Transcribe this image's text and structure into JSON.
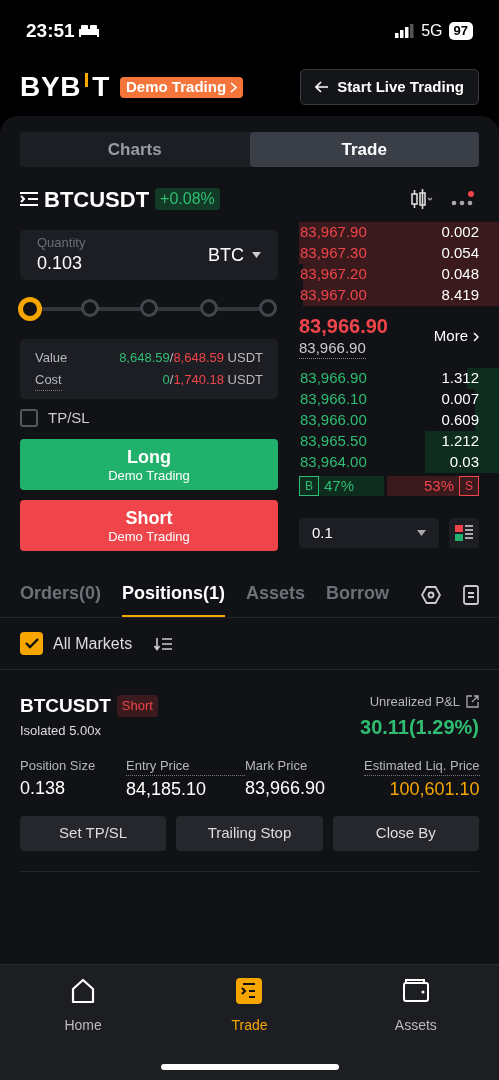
{
  "status_bar": {
    "time": "23:51",
    "network": "5G",
    "battery": "97"
  },
  "header": {
    "logo_left": "BYB",
    "logo_right": "T",
    "demo_badge": "Demo Trading",
    "live_button": "Start Live Trading"
  },
  "view_tabs": [
    {
      "label": "Charts",
      "selected": false
    },
    {
      "label": "Trade",
      "selected": true
    }
  ],
  "symbol_bar": {
    "symbol": "BTCUSDT",
    "change": "+0.08%",
    "has_notification": true
  },
  "order_form": {
    "quantity": {
      "label": "Quantity",
      "value": "0.103",
      "unit": "BTC"
    },
    "slider": {
      "level": 0
    },
    "value": {
      "label": "Value",
      "available": "8,648.59",
      "separator": "/",
      "max": "8,648.59",
      "unit": "USDT"
    },
    "cost": {
      "label": "Cost",
      "available": "0",
      "separator": "/",
      "max": "1,740.18",
      "unit": "USDT"
    },
    "tpsl": {
      "label": "TP/SL",
      "checked": false
    },
    "long": {
      "label": "Long",
      "sub": "Demo Trading"
    },
    "short": {
      "label": "Short",
      "sub": "Demo Trading"
    }
  },
  "order_book": {
    "asks": [
      {
        "price": "83,967.90",
        "size": "0.002"
      },
      {
        "price": "83,967.30",
        "size": "0.054"
      },
      {
        "price": "83,967.20",
        "size": "0.048"
      },
      {
        "price": "83,967.00",
        "size": "8.419"
      }
    ],
    "last_price": "83,966.90",
    "mark_price": "83,966.90",
    "more": "More",
    "bids": [
      {
        "price": "83,966.90",
        "size": "1.312"
      },
      {
        "price": "83,966.10",
        "size": "0.007"
      },
      {
        "price": "83,966.00",
        "size": "0.609"
      },
      {
        "price": "83,965.50",
        "size": "1.212"
      },
      {
        "price": "83,964.00",
        "size": "0.03"
      }
    ],
    "ratio": {
      "buy_tag": "B",
      "buy": "47%",
      "sell": "53%",
      "sell_tag": "S"
    },
    "precision": "0.1"
  },
  "position_tabs": [
    {
      "label": "Orders(0)",
      "selected": false
    },
    {
      "label": "Positions(1)",
      "selected": true
    },
    {
      "label": "Assets",
      "selected": false
    },
    {
      "label": "Borrow",
      "selected": false
    }
  ],
  "filter": {
    "label": "All Markets",
    "checked": true
  },
  "position": {
    "symbol": "BTCUSDT",
    "side": "Short",
    "margin": "Isolated 5.00x",
    "pnl_label": "Unrealized P&L",
    "pnl": "30.11(1.29%)",
    "fields": [
      {
        "label": "Position Size",
        "value": "0.138",
        "highlight": false
      },
      {
        "label": "Entry Price",
        "value": "84,185.10",
        "highlight": false
      },
      {
        "label": "Mark Price",
        "value": "83,966.90",
        "highlight": false
      },
      {
        "label": "Estimated Liq. Price",
        "value": "100,601.10",
        "highlight": true
      }
    ],
    "actions": [
      "Set TP/SL",
      "Trailing Stop",
      "Close By"
    ]
  },
  "bottom_nav": [
    {
      "label": "Home",
      "kind": "home",
      "selected": false
    },
    {
      "label": "Trade",
      "kind": "trade",
      "selected": true
    },
    {
      "label": "Assets",
      "kind": "wallet",
      "selected": false
    }
  ]
}
